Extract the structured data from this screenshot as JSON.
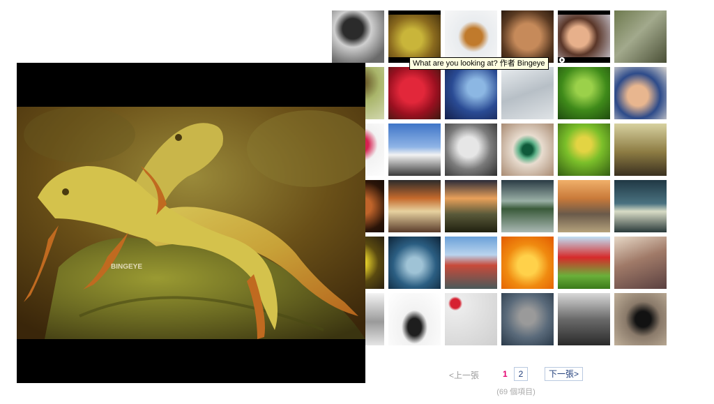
{
  "tooltip": {
    "text": "What are you looking at? 作者 Bingeye"
  },
  "viewer": {
    "watermark": "BINGEYE"
  },
  "pagination": {
    "prev_label": "<上一張",
    "current_page": "1",
    "page_2_label": "2",
    "next_label": "下一張>",
    "item_count": "(69 個項目)"
  },
  "accent_colors": {
    "current_page": "#e4006f",
    "link": "#1f3d7a",
    "disabled": "#9a9a9a"
  }
}
